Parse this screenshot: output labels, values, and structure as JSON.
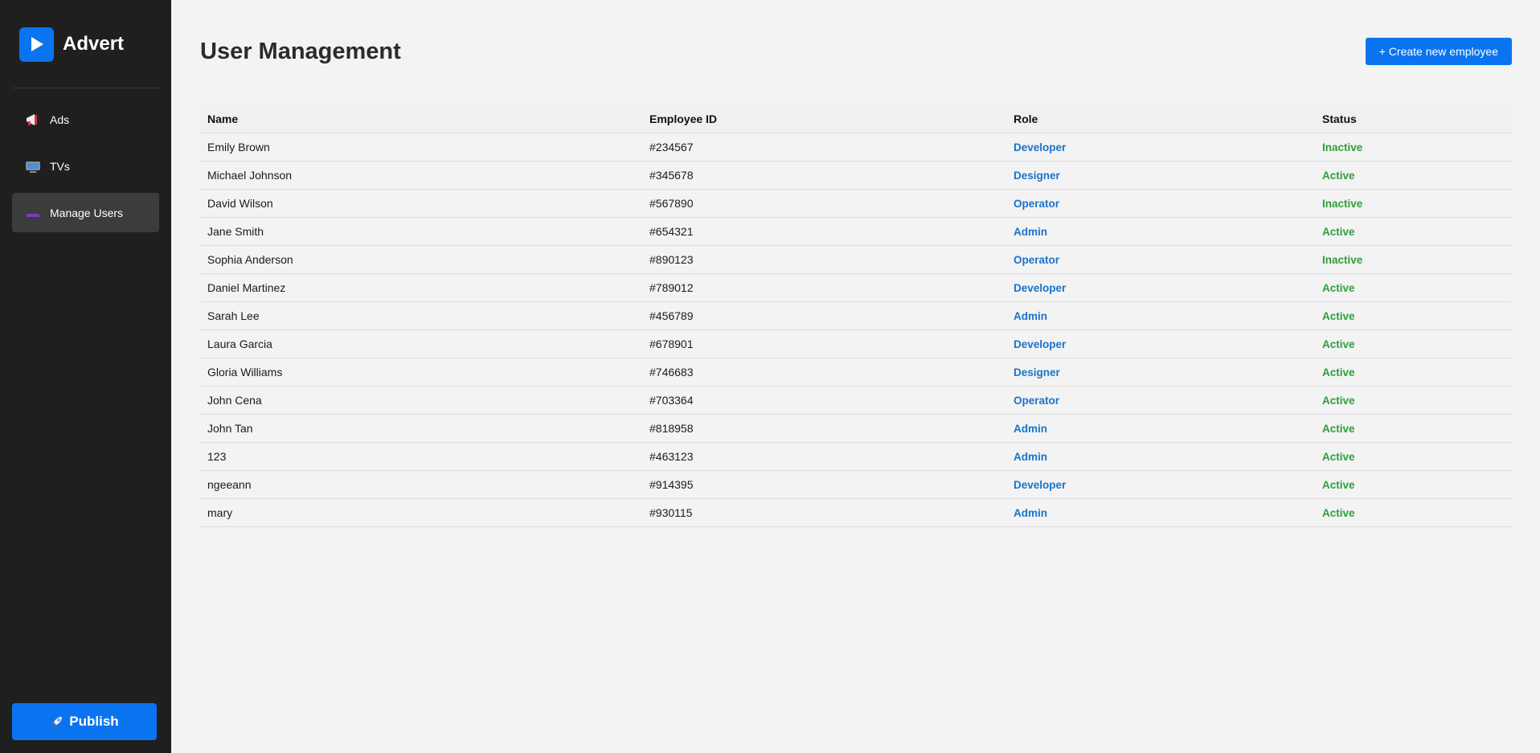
{
  "brand": {
    "name": "Advert",
    "logo_icon": "play-icon",
    "accent": "#0a74f0"
  },
  "sidebar": {
    "items": [
      {
        "label": "Ads",
        "icon": "megaphone-icon",
        "active": false
      },
      {
        "label": "TVs",
        "icon": "tv-icon",
        "active": false
      },
      {
        "label": "Manage Users",
        "icon": "users-icon",
        "active": true
      }
    ],
    "publish_label": "Publish",
    "publish_icon": "rocket-icon"
  },
  "header": {
    "title": "User Management",
    "create_label": "+ Create new employee"
  },
  "table": {
    "columns": [
      "Name",
      "Employee ID",
      "Role",
      "Status"
    ],
    "rows": [
      [
        "Emily Brown",
        "#234567",
        "Developer",
        "Inactive"
      ],
      [
        "Michael Johnson",
        "#345678",
        "Designer",
        "Active"
      ],
      [
        "David Wilson",
        "#567890",
        "Operator",
        "Inactive"
      ],
      [
        "Jane Smith",
        "#654321",
        "Admin",
        "Active"
      ],
      [
        "Sophia Anderson",
        "#890123",
        "Operator",
        "Inactive"
      ],
      [
        "Daniel Martinez",
        "#789012",
        "Developer",
        "Active"
      ],
      [
        "Sarah Lee",
        "#456789",
        "Admin",
        "Active"
      ],
      [
        "Laura Garcia",
        "#678901",
        "Developer",
        "Active"
      ],
      [
        "Gloria Williams",
        "#746683",
        "Designer",
        "Active"
      ],
      [
        "John Cena",
        "#703364",
        "Operator",
        "Active"
      ],
      [
        "John Tan",
        "#818958",
        "Admin",
        "Active"
      ],
      [
        "123",
        "#463123",
        "Admin",
        "Active"
      ],
      [
        "ngeeann",
        "#914395",
        "Developer",
        "Active"
      ],
      [
        "mary",
        "#930115",
        "Admin",
        "Active"
      ]
    ]
  },
  "colors": {
    "role": "#1a73c9",
    "status": "#2e9e3e",
    "sidebar_bg": "#1f1f1f"
  }
}
